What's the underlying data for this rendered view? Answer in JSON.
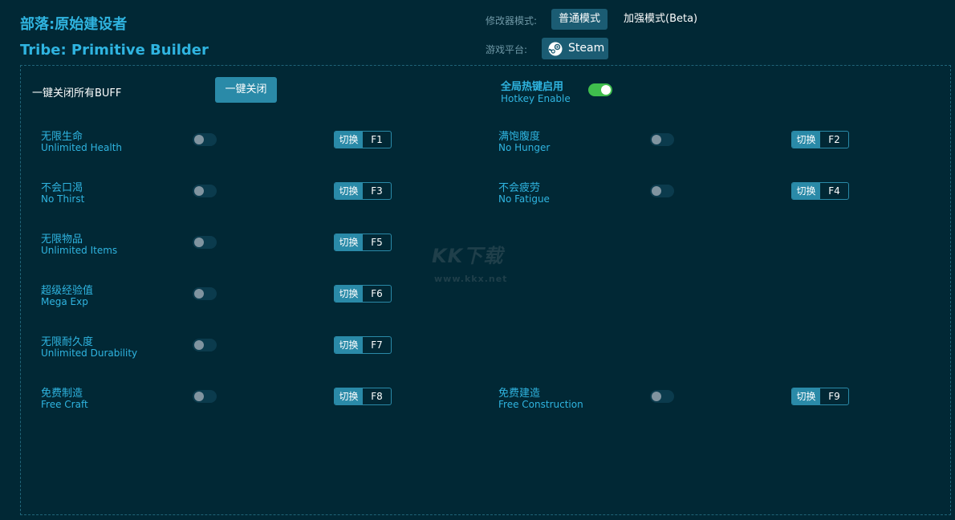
{
  "header": {
    "title_cn": "部落:原始建设者",
    "title_en": "Tribe: Primitive Builder",
    "mode_label": "修改器模式:",
    "modes": [
      "普通模式",
      "加强模式(Beta)"
    ],
    "platform_label": "游戏平台:",
    "platform": "Steam"
  },
  "controls": {
    "close_all_label": "一键关闭所有BUFF",
    "close_all_button": "一键关闭",
    "hotkey_cn": "全局热键启用",
    "hotkey_en": "Hotkey Enable",
    "hotkey_enabled": true
  },
  "switch_label": "切换",
  "options": [
    {
      "cn": "无限生命",
      "en": "Unlimited Health",
      "key": "F1",
      "enabled": false
    },
    {
      "cn": "满饱腹度",
      "en": "No Hunger",
      "key": "F2",
      "enabled": false
    },
    {
      "cn": "不会口渴",
      "en": "No Thirst",
      "key": "F3",
      "enabled": false
    },
    {
      "cn": "不会疲劳",
      "en": "No Fatigue",
      "key": "F4",
      "enabled": false
    },
    {
      "cn": "无限物品",
      "en": "Unlimited Items",
      "key": "F5",
      "enabled": false
    },
    {
      "cn": "超级经验值",
      "en": "Mega Exp",
      "key": "F6",
      "enabled": false
    },
    {
      "cn": "无限耐久度",
      "en": "Unlimited Durability",
      "key": "F7",
      "enabled": false
    },
    {
      "cn": "免费制造",
      "en": "Free Craft",
      "key": "F8",
      "enabled": false
    },
    {
      "cn": "免费建造",
      "en": "Free Construction",
      "key": "F9",
      "enabled": false
    }
  ],
  "watermark": {
    "logo": "KK下载",
    "url": "www.kkx.net"
  },
  "colors": {
    "background": "#012835",
    "accent": "#2fb4e0",
    "button": "#2a8aa8",
    "toggle_on": "#3fbe4d"
  },
  "icons": [
    "steam-icon"
  ]
}
